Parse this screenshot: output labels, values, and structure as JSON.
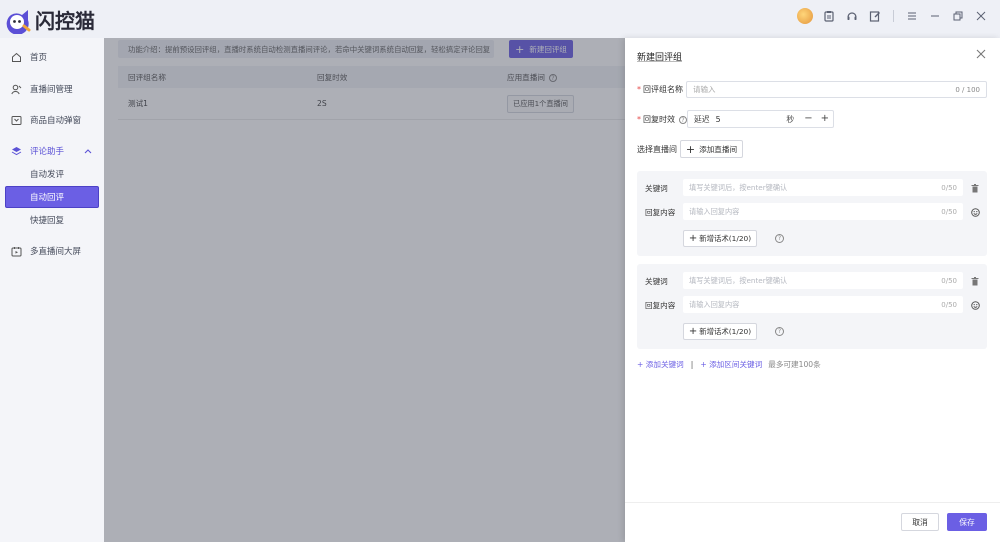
{
  "app": {
    "name": "闪控猫"
  },
  "topbar": {
    "icons": [
      "avatar-icon",
      "clipboard-icon",
      "headset-icon",
      "edit-icon",
      "menu-icon",
      "minimize-icon",
      "restore-icon",
      "close-icon"
    ]
  },
  "sidebar": {
    "items": [
      {
        "label": "首页",
        "icon": "home-icon"
      },
      {
        "label": "直播间管理",
        "icon": "user-icon"
      },
      {
        "label": "商品自动弹窗",
        "icon": "box-icon"
      },
      {
        "label": "评论助手",
        "icon": "comment-icon",
        "expanded": true,
        "children": [
          {
            "label": "自动发评"
          },
          {
            "label": "自动回评",
            "active": true
          },
          {
            "label": "快捷回复"
          }
        ]
      },
      {
        "label": "多直播间大屏",
        "icon": "screen-icon"
      }
    ]
  },
  "main": {
    "intro": "功能介绍：提前预设回评组，直播时系统自动检测直播间评论，若命中关键词系统自动回复，轻松搞定评论回复",
    "new_button": "新建回评组",
    "table": {
      "headers": [
        "回评组名称",
        "回复时效",
        "应用直播间"
      ],
      "rows": [
        {
          "name": "测试1",
          "delay": "2S",
          "applied": "已应用1个直播间"
        }
      ]
    }
  },
  "drawer": {
    "title": "新建回评组",
    "name_label": "回评组名称",
    "name_placeholder": "请输入",
    "name_count": "0 / 100",
    "delay_label": "回复时效",
    "delay_prefix": "延迟",
    "delay_value": "5",
    "delay_unit": "秒",
    "room_label": "选择直播间",
    "add_room_button": "添加直播间",
    "rules": [
      {
        "keyword_label": "关键词",
        "keyword_placeholder": "填写关键词后，按enter键确认",
        "keyword_count": "0/50",
        "reply_label": "回复内容",
        "reply_placeholder": "请输入回复内容",
        "reply_count": "0/50",
        "add_script_button": "新增话术(1/20)"
      },
      {
        "keyword_label": "关键词",
        "keyword_placeholder": "填写关键词后，按enter键确认",
        "keyword_count": "0/50",
        "reply_label": "回复内容",
        "reply_placeholder": "请输入回复内容",
        "reply_count": "0/50",
        "add_script_button": "新增话术(1/20)"
      }
    ],
    "add_keyword_link": "+ 添加关键词",
    "add_range_link": "+ 添加区间关键词",
    "limit_hint": "最多可建100条",
    "cancel_button": "取消",
    "save_button": "保存"
  },
  "colors": {
    "accent": "#6b5fe4",
    "required": "#e54a4a"
  }
}
